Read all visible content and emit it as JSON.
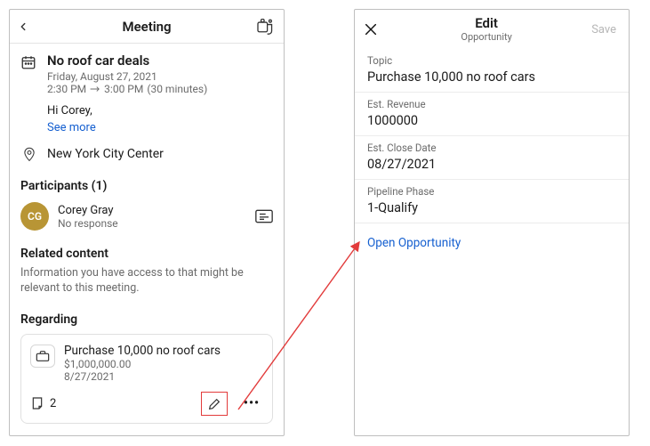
{
  "meeting": {
    "header_title": "Meeting",
    "event_title": "No roof car deals",
    "event_date": "Friday, August 27, 2021",
    "event_time_start": "2:30 PM",
    "event_time_end": "3:00 PM",
    "event_duration": "(30 minutes)",
    "greeting": "Hi Corey,",
    "see_more": "See more",
    "location": "New York City Center",
    "participants_heading": "Participants (1)",
    "participant": {
      "initials": "CG",
      "name": "Corey Gray",
      "status": "No response"
    },
    "related_heading": "Related content",
    "related_text": "Information you have access to that might be relevant to this meeting.",
    "regarding_heading": "Regarding",
    "regarding": {
      "title": "Purchase 10,000 no roof cars",
      "revenue": "$1,000,000.00",
      "date": "8/27/2021",
      "notes_count": "2"
    },
    "more_symbol": "•••"
  },
  "edit": {
    "title": "Edit",
    "subtitle": "Opportunity",
    "save": "Save",
    "fields": {
      "topic_label": "Topic",
      "topic_value": "Purchase 10,000 no roof cars",
      "rev_label": "Est. Revenue",
      "rev_value": "1000000",
      "close_label": "Est. Close Date",
      "close_value": "08/27/2021",
      "phase_label": "Pipeline Phase",
      "phase_value": "1-Qualify"
    },
    "open_link": "Open Opportunity"
  }
}
